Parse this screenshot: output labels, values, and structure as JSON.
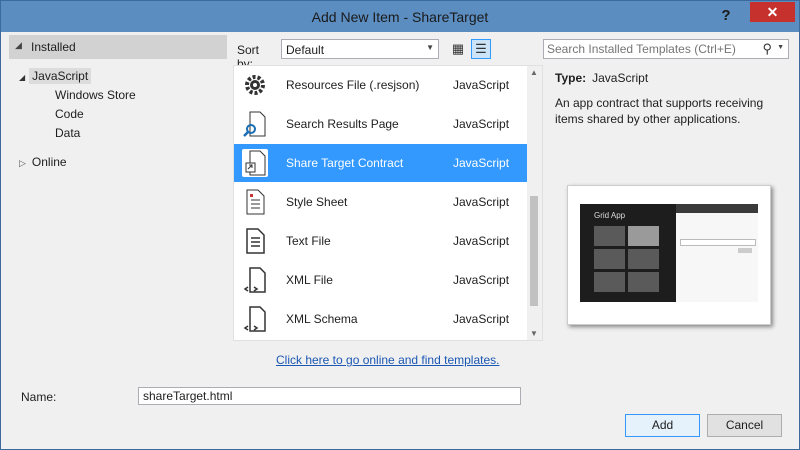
{
  "window": {
    "title": "Add New Item - ShareTarget",
    "help": "?",
    "close": "✕"
  },
  "left": {
    "installed": "Installed",
    "tree": [
      {
        "label": "JavaScript"
      },
      {
        "label": "Windows Store"
      },
      {
        "label": "Code"
      },
      {
        "label": "Data"
      },
      {
        "label": "Online"
      }
    ]
  },
  "toolbar": {
    "sort_label": "Sort by:",
    "sort_value": "Default"
  },
  "search": {
    "placeholder": "Search Installed Templates (Ctrl+E)"
  },
  "templates": [
    {
      "name": "Resources File (.resjson)",
      "lang": "JavaScript",
      "icon": "gear-icon"
    },
    {
      "name": "Search Results Page",
      "lang": "JavaScript",
      "icon": "search-page-icon"
    },
    {
      "name": "Share Target Contract",
      "lang": "JavaScript",
      "icon": "share-target-icon",
      "selected": true
    },
    {
      "name": "Style Sheet",
      "lang": "JavaScript",
      "icon": "stylesheet-icon"
    },
    {
      "name": "Text File",
      "lang": "JavaScript",
      "icon": "text-file-icon"
    },
    {
      "name": "XML File",
      "lang": "JavaScript",
      "icon": "xml-file-icon"
    },
    {
      "name": "XML Schema",
      "lang": "JavaScript",
      "icon": "xml-schema-icon"
    }
  ],
  "online_link": "Click here to go online and find templates.",
  "details": {
    "type_label": "Type:",
    "type_value": "JavaScript",
    "description": "An app contract that supports receiving items shared by other applications.",
    "preview_app_title": "Grid App"
  },
  "name_field": {
    "label": "Name:",
    "value": "shareTarget.html"
  },
  "buttons": {
    "add": "Add",
    "cancel": "Cancel"
  },
  "colors": {
    "selection": "#3399ff",
    "titlebar": "#5b8dc0",
    "close": "#c7312d",
    "link": "#1b57b3"
  }
}
